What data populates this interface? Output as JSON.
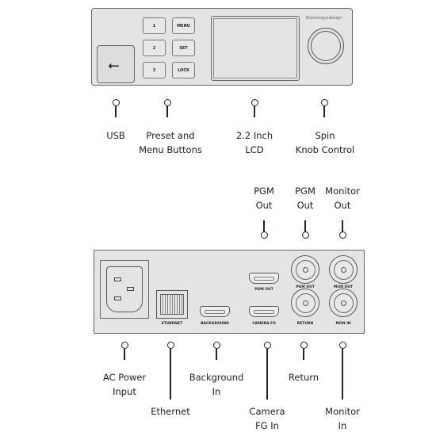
{
  "front_panel": {
    "buttons": [
      "1",
      "MENU",
      "2",
      "SET",
      "3",
      "LOCK"
    ],
    "logo": "Blackmagicdesign"
  },
  "front_callouts": [
    {
      "label": "USB"
    },
    {
      "label": "Preset and\nMenu Buttons"
    },
    {
      "label": "2.2 Inch\nLCD"
    },
    {
      "label": "Spin\nKnob Control"
    }
  ],
  "rear_top_callouts": [
    {
      "label": "PGM\nOut"
    },
    {
      "label": "PGM\nOut"
    },
    {
      "label": "Monitor\nOut"
    }
  ],
  "rear_panel": {
    "ports": {
      "ethernet": "ETHERNET",
      "background": "BACKGROUND",
      "pgm_out_hdmi": "PGM OUT",
      "camera_fg": "CAMERA FG",
      "pgm_out_sdi": "PGM OUT",
      "mon_out": "MON OUT",
      "return": "RETURN",
      "mon_in": "MON IN"
    }
  },
  "rear_bottom_callouts": [
    {
      "label": "AC Power\nInput"
    },
    {
      "label": "Ethernet"
    },
    {
      "label": "Background\nIn"
    },
    {
      "label": "Camera\nFG In"
    },
    {
      "label": "Return"
    },
    {
      "label": "Monitor\nIn"
    }
  ]
}
